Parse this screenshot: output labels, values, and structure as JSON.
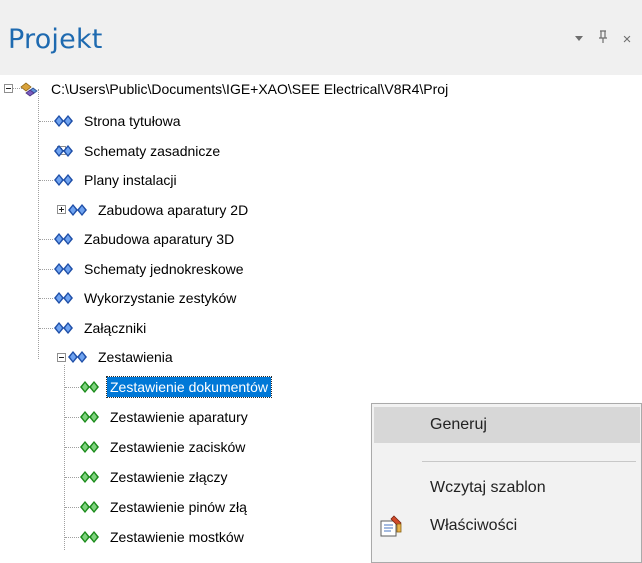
{
  "panel": {
    "title": "Projekt",
    "dropdown_glyph": "▾",
    "pin_glyph": "ᵖ",
    "close_glyph": "×",
    "colors": {
      "title": "#1e6ab0",
      "selection": "#0078d7"
    }
  },
  "tree": {
    "root": {
      "label": "C:\\Users\\Public\\Documents\\IGE+XAO\\SEE Electrical\\V8R4\\Proj",
      "icon": "project-root-icon"
    },
    "items": [
      {
        "label": "Strona tytułowa",
        "icon": "folder-gem-icon"
      },
      {
        "label": "Schematy zasadnicze",
        "icon": "folder-gem-icon"
      },
      {
        "label": "Plany instalacji",
        "icon": "folder-gem-icon"
      },
      {
        "label": "Zabudowa aparatury 2D",
        "icon": "folder-gem-icon"
      },
      {
        "label": "Zabudowa aparatury 3D",
        "icon": "folder-gem-icon"
      },
      {
        "label": "Schematy jednokreskowe",
        "icon": "folder-gem-icon"
      },
      {
        "label": "Wykorzystanie zestyków",
        "icon": "folder-gem-icon"
      },
      {
        "label": "Załączniki",
        "icon": "folder-gem-icon"
      },
      {
        "label": "Zestawienia",
        "icon": "folder-gem-icon"
      }
    ],
    "children": [
      {
        "label": "Zestawienie dokumentów",
        "icon": "report-gem-icon",
        "selected": true
      },
      {
        "label": "Zestawienie aparatury",
        "icon": "report-gem-icon"
      },
      {
        "label": "Zestawienie zacisków",
        "icon": "report-gem-icon"
      },
      {
        "label": "Zestawienie złączy",
        "icon": "report-gem-icon"
      },
      {
        "label": "Zestawienie pinów złą",
        "icon": "report-gem-icon"
      },
      {
        "label": "Zestawienie mostków",
        "icon": "report-gem-icon"
      }
    ]
  },
  "context_menu": {
    "items": [
      {
        "label": "Generuj",
        "highlighted": true
      },
      {
        "label": "Wczytaj szablon"
      },
      {
        "label": "Właściwości",
        "icon": "properties-icon"
      }
    ]
  }
}
